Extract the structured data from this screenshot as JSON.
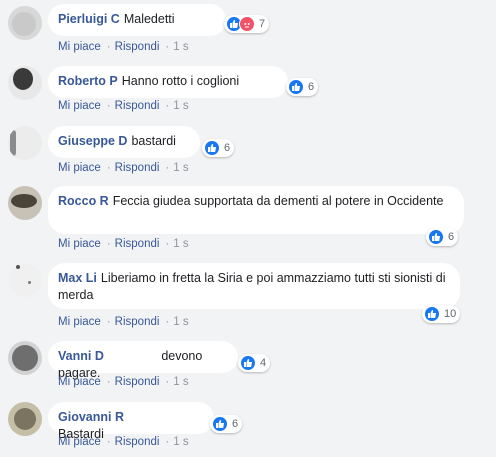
{
  "actions": {
    "like": "Mi piace",
    "reply": "Rispondi",
    "separator": "·"
  },
  "comments": [
    {
      "author": "Pierluigi C",
      "text": "Maledetti",
      "count": "7",
      "time": "1 s"
    },
    {
      "author": "Roberto P",
      "text": "Hanno rotto i coglioni",
      "count": "6",
      "time": "1 s"
    },
    {
      "author": "Giuseppe D",
      "text": "bastardi",
      "count": "6",
      "time": "1 s"
    },
    {
      "author": "Rocco R",
      "text": "Feccia giudea supportata da dementi al potere in Occidente",
      "count": "6",
      "time": "1 s"
    },
    {
      "author": "Max Li",
      "text": "Liberiamo in fretta la Siria e poi ammazziamo tutti sti sionisti di merda",
      "count": "10",
      "time": "1 s"
    },
    {
      "author": "Vanni D",
      "text": "devono pagare.",
      "count": "4",
      "time": "1 s"
    },
    {
      "author": "Giovanni R",
      "text": "Bastardi",
      "count": "6",
      "time": "1 s"
    }
  ],
  "colors": {
    "link": "#385898",
    "like": "#1877f2",
    "angry": "#f25268",
    "background": "#f2f3f5"
  },
  "icons": {
    "like": "thumbs-up-icon",
    "angry": "angry-face-icon"
  }
}
